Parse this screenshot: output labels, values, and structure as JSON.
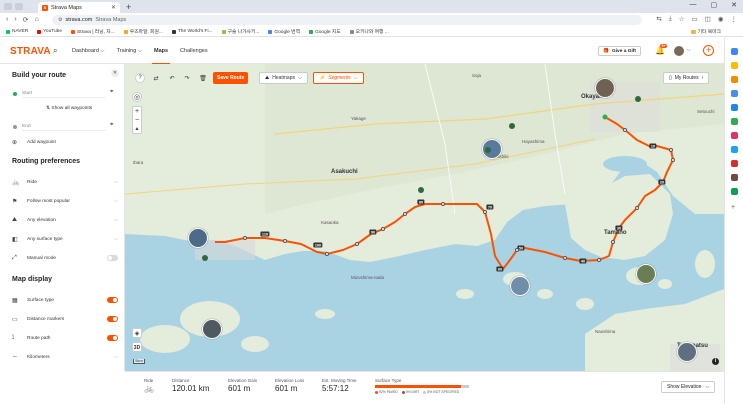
{
  "browser": {
    "tab_title": "Strava Maps",
    "new_tab": "+",
    "window_controls": [
      "—",
      "▢",
      "✕"
    ],
    "nav_icons": [
      "‹",
      "›",
      "⟳",
      "⌂"
    ],
    "url_host": "strava.com",
    "url_title": "Strava Maps",
    "bookmarks": [
      {
        "label": "NAVER",
        "color": "#03c75a"
      },
      {
        "label": "YouTube",
        "color": "#ff0000"
      },
      {
        "label": "Strava | 러닝, 자...",
        "color": "#fc5200"
      },
      {
        "label": "우즈파일: 회원...",
        "color": "#f5a623"
      },
      {
        "label": "The World's Fi...",
        "color": "#333333"
      },
      {
        "label": "구슬 나가사키...",
        "color": "#8bc34a"
      },
      {
        "label": "Google 번역",
        "color": "#4285f4"
      },
      {
        "label": "Google 지도",
        "color": "#34a853"
      },
      {
        "label": "오키나와 여행 ...",
        "color": "#888888"
      }
    ],
    "bookmarks_folder": "기타 북마크"
  },
  "header": {
    "logo": "STRAVA",
    "nav": [
      {
        "label": "Dashboard ⌵",
        "active": false
      },
      {
        "label": "Training ⌵",
        "active": false
      },
      {
        "label": "Maps",
        "active": true
      },
      {
        "label": "Challenges",
        "active": false
      }
    ],
    "gift_label": "Give a Gift",
    "notif_badge": "9+",
    "plus": "+"
  },
  "panel": {
    "title": "Build your route",
    "start_placeholder": "Start",
    "show_all_waypoints": "Show all waypoints",
    "end_placeholder": "End",
    "add_waypoint": "Add waypoint",
    "routing_title": "Routing preferences",
    "routing_items": [
      {
        "icon": "bike-icon",
        "glyph": "🚲",
        "label": "Ride"
      },
      {
        "icon": "popular-icon",
        "glyph": "⚑",
        "label": "Follow most popular"
      },
      {
        "icon": "elevation-icon",
        "glyph": "⛰",
        "label": "Any elevation"
      },
      {
        "icon": "surface-icon",
        "glyph": "◧",
        "label": "Any surface type"
      },
      {
        "icon": "manual-icon",
        "glyph": "⤢",
        "label": "Manual mode"
      }
    ],
    "display_title": "Map display",
    "display_items": [
      {
        "icon": "surface-type-icon",
        "glyph": "▦",
        "label": "Surface type",
        "on": true
      },
      {
        "icon": "distance-markers-icon",
        "glyph": "▭",
        "label": "Distance markers",
        "on": true
      },
      {
        "icon": "route-path-icon",
        "glyph": "⟟",
        "label": "Route path",
        "on": true
      },
      {
        "icon": "kilometers-icon",
        "glyph": "⇔",
        "label": "Kilometers",
        "on": null
      }
    ]
  },
  "map_toolbar": {
    "save_label": "Save Route",
    "heatmaps_label": "Heatmaps",
    "segments_label": "Segments",
    "my_routes_label": "My Routes",
    "layers_label": "3D",
    "scale_label": "5km"
  },
  "map_labels": [
    {
      "text": "Soja",
      "big": false
    },
    {
      "text": "Okayama",
      "big": true
    },
    {
      "text": "Ibara",
      "big": false
    },
    {
      "text": "Yakage",
      "big": false
    },
    {
      "text": "Kurashiki",
      "big": false
    },
    {
      "text": "Hayashima",
      "big": false
    },
    {
      "text": "Asakuchi",
      "big": true
    },
    {
      "text": "Kasaoka",
      "big": false
    },
    {
      "text": "Tamano",
      "big": true
    },
    {
      "text": "Mizushima-nada",
      "big": false
    },
    {
      "text": "Takamatsu",
      "big": true
    },
    {
      "text": "Naoshima",
      "big": false
    },
    {
      "text": "Setouchi",
      "big": false
    }
  ],
  "distance_markers": [
    "10",
    "20",
    "30",
    "40",
    "50",
    "60",
    "70",
    "80",
    "90",
    "100",
    "110",
    "120"
  ],
  "stats": {
    "ride_label": "Ride",
    "distance_label": "Distance",
    "distance_value": "120.01 km",
    "gain_label": "Elevation Gain",
    "gain_value": "601 m",
    "loss_label": "Elevation Loss",
    "loss_value": "601 m",
    "time_label": "Est. Moving Time",
    "time_value": "5:57:12",
    "surface_label": "Surface Type",
    "surface_breakdown": [
      {
        "label": "92% PAVED",
        "pct": 92,
        "color": "#fc5200"
      },
      {
        "label": "0% DIRT",
        "pct": 0,
        "color": "#a0522d"
      },
      {
        "label": "8% NOT SPECIFIED",
        "pct": 8,
        "color": "#c9c9cf"
      }
    ],
    "show_elevation": "Show Elevation"
  },
  "colors": {
    "brand": "#fc5200",
    "water": "#a9d3e3",
    "land": "#e4ecdc",
    "route": "#fc5200"
  }
}
